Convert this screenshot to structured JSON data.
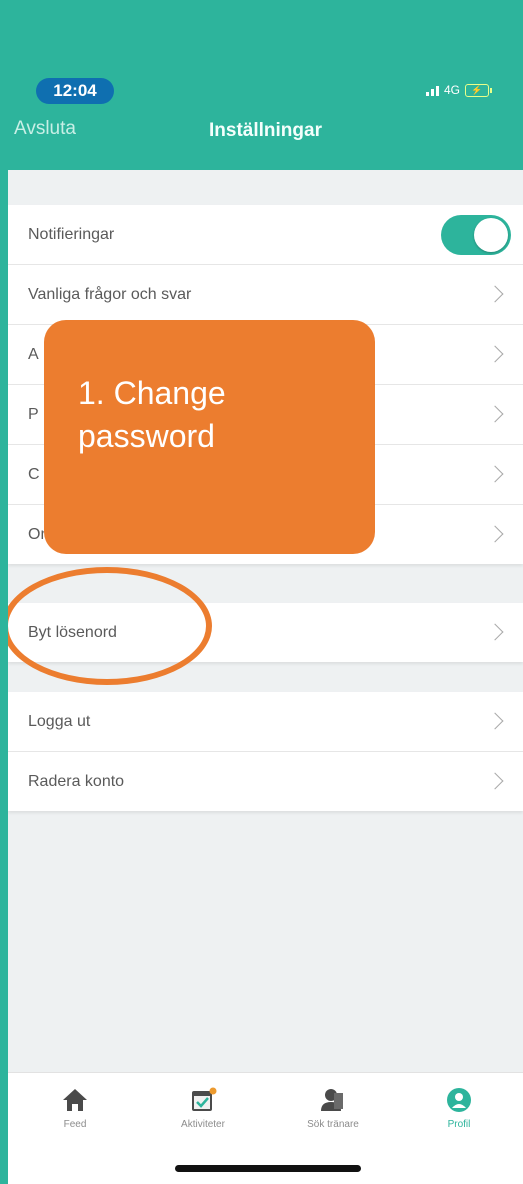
{
  "status": {
    "time": "12:04",
    "network": "4G"
  },
  "header": {
    "back_label": "Avsluta",
    "title": "Inställningar"
  },
  "groups": [
    {
      "rows": [
        {
          "label": "Notifieringar",
          "toggle": true
        },
        {
          "label": "Vanliga frågor och svar"
        },
        {
          "label": "A"
        },
        {
          "label": "P"
        },
        {
          "label": "C"
        },
        {
          "label": "Om"
        }
      ]
    },
    {
      "rows": [
        {
          "label": "Byt lösenord"
        }
      ]
    },
    {
      "rows": [
        {
          "label": "Logga ut"
        },
        {
          "label": "Radera konto"
        }
      ]
    }
  ],
  "callout": {
    "text": "1. Change password"
  },
  "tabbar": {
    "items": [
      {
        "label": "Feed",
        "icon": "home-icon",
        "active": false
      },
      {
        "label": "Aktiviteter",
        "icon": "calendar-check-icon",
        "active": false
      },
      {
        "label": "Sök tränare",
        "icon": "person-search-icon",
        "active": false
      },
      {
        "label": "Profil",
        "icon": "profile-icon",
        "active": true
      }
    ]
  },
  "colors": {
    "accent": "#2db49c",
    "callout": "#ec7d2f",
    "time_pill": "#0f6fb0"
  }
}
